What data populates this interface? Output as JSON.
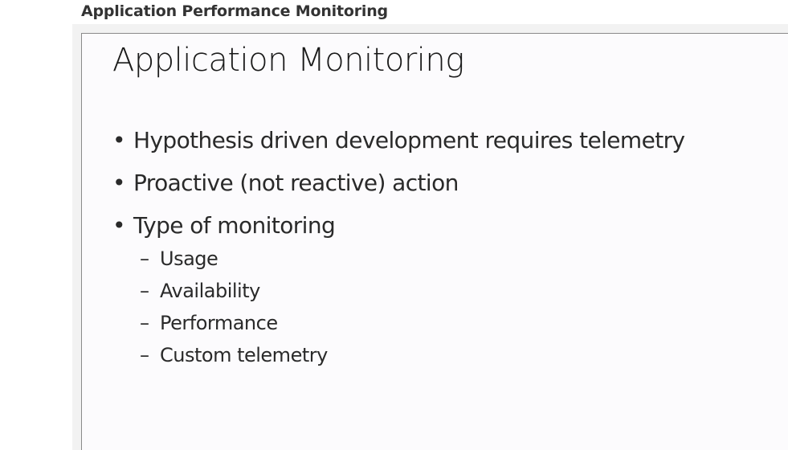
{
  "page": {
    "header": "Application Performance Monitoring"
  },
  "slide": {
    "title": "Application Monitoring",
    "bullets": [
      "Hypothesis driven development requires telemetry",
      "Proactive (not reactive) action",
      "Type of monitoring"
    ],
    "subitems": [
      "Usage",
      "Availability",
      "Performance",
      "Custom telemetry"
    ],
    "bullet_symbol": "•",
    "sub_symbol": "–"
  },
  "colors": {
    "frame": "#f2f2f2",
    "slide_background": "#fcfbfd",
    "text": "#2a2a2a"
  }
}
